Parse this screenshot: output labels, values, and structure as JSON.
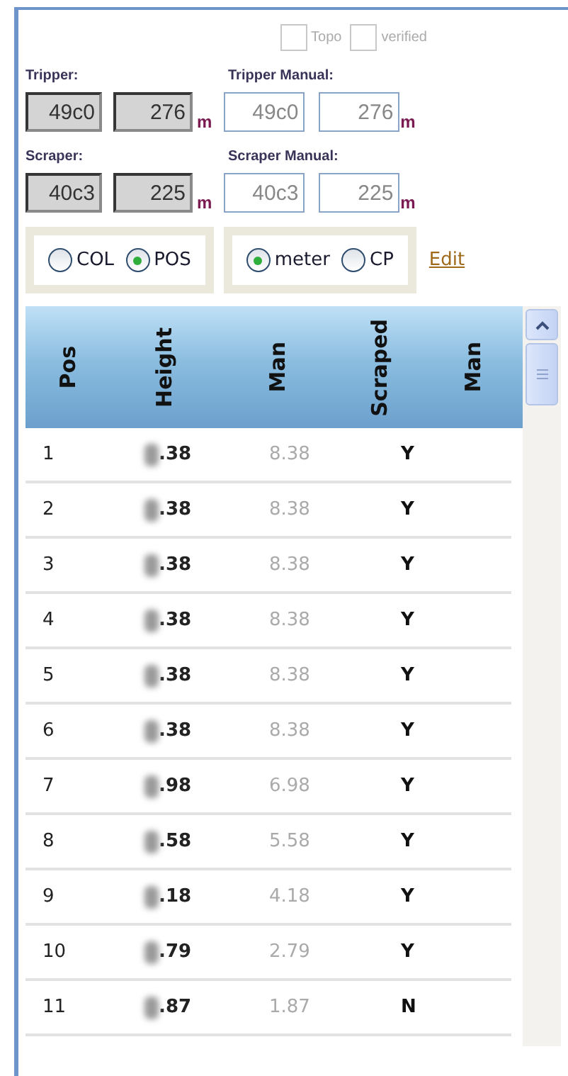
{
  "flags": [
    {
      "label": "Topo",
      "checked": false,
      "disabled": true
    },
    {
      "label": "verified",
      "checked": false,
      "disabled": true
    }
  ],
  "groups": [
    {
      "label": "Tripper:",
      "code": "49c0",
      "distance": "276",
      "unit": "m",
      "manual_label": "Tripper Manual:",
      "manual_code": "49c0",
      "manual_distance": "276",
      "manual_unit": "m"
    },
    {
      "label": "Scraper:",
      "code": "40c3",
      "distance": "225",
      "unit": "m",
      "manual_label": "Scraper Manual:",
      "manual_code": "40c3",
      "manual_distance": "225",
      "manual_unit": "m"
    }
  ],
  "radio_groups": [
    [
      {
        "label": "COL",
        "selected": false
      },
      {
        "label": "POS",
        "selected": true
      }
    ],
    [
      {
        "label": "meter",
        "selected": true
      },
      {
        "label": "CP",
        "selected": false
      }
    ]
  ],
  "edit_link": "Edit",
  "table": {
    "columns": [
      "Pos",
      "Height",
      "Man",
      "Scraped",
      "Man"
    ],
    "rows": [
      [
        "1",
        ".38",
        "8.38",
        "Y"
      ],
      [
        "2",
        ".38",
        "8.38",
        "Y"
      ],
      [
        "3",
        ".38",
        "8.38",
        "Y"
      ],
      [
        "4",
        ".38",
        "8.38",
        "Y"
      ],
      [
        "5",
        ".38",
        "8.38",
        "Y"
      ],
      [
        "6",
        ".38",
        "8.38",
        "Y"
      ],
      [
        "7",
        ".98",
        "6.98",
        "Y"
      ],
      [
        "8",
        ".58",
        "5.58",
        "Y"
      ],
      [
        "9",
        ".18",
        "4.18",
        "Y"
      ],
      [
        "10",
        ".79",
        "2.79",
        "Y"
      ],
      [
        "11",
        ".87",
        "1.87",
        "N"
      ]
    ]
  }
}
